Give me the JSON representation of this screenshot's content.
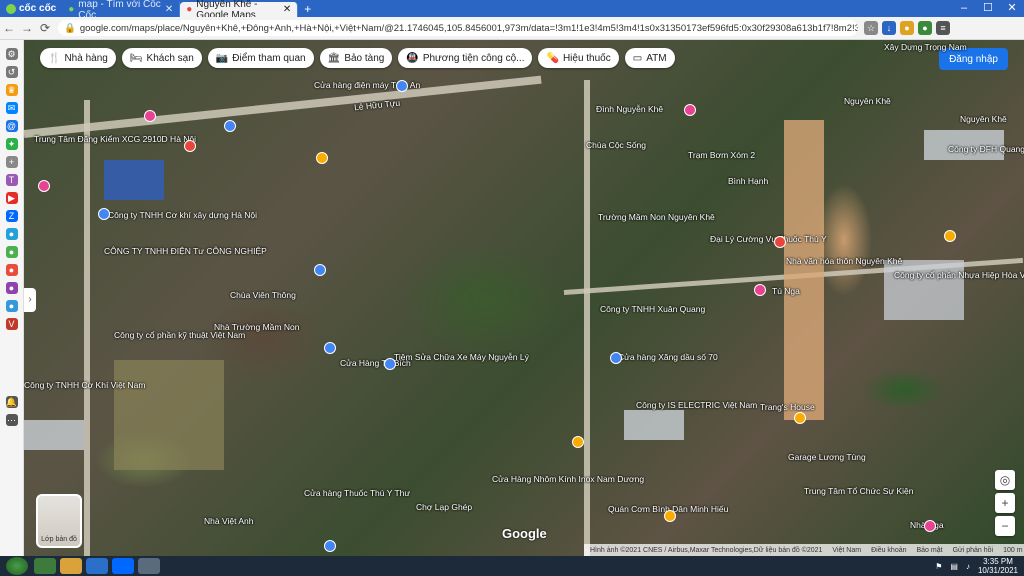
{
  "browser": {
    "brand": "cốc cốc",
    "tabs": [
      {
        "label": "map - Tìm với Cốc Cốc",
        "active": false
      },
      {
        "label": "Nguyên Khê - Google Maps",
        "active": true
      }
    ],
    "url": "google.com/maps/place/Nguyên+Khê,+Đông+Anh,+Hà+Nội,+Việt+Nam/@21.1746045,105.8456001,973m/data=!3m1!1e3!4m5!3m4!1s0x31350173ef596fd5:0x30f29308a613b1f7!8m2!3d21.177006!4d105.8349009"
  },
  "map": {
    "chips": [
      {
        "icon": "restaurant-icon",
        "label": "Nhà hàng"
      },
      {
        "icon": "hotel-icon",
        "label": "Khách sạn"
      },
      {
        "icon": "camera-icon",
        "label": "Điểm tham quan"
      },
      {
        "icon": "museum-icon",
        "label": "Bảo tàng"
      },
      {
        "icon": "transit-icon",
        "label": "Phương tiện công cộ..."
      },
      {
        "icon": "pharmacy-icon",
        "label": "Hiệu thuốc"
      },
      {
        "icon": "atm-icon",
        "label": "ATM"
      }
    ],
    "signin": "Đăng nhập",
    "layer_label": "Lớp bản đồ",
    "google_logo": "Google",
    "labels": [
      "Lê Hữu Tựu",
      "Nguyên Khê",
      "Nguyên Khê",
      "Trung Tâm Đăng Kiểm XCG 2910D Hà Nội",
      "Cửa hàng điện máy Tâm An",
      "Công ty TNHH Cơ khí xây dựng Hà Nội",
      "CÔNG TY TNHH ĐIỆN Tư CÔNG NGHIỆP",
      "Chùa Viên Thông",
      "Công ty cổ phần kỹ thuật Việt Nam",
      "Nhà Trường Mầm Non",
      "Cửa Hàng Tú Bích",
      "Tiệm Sửa Chữa Xe Máy Nguyễn Lý",
      "Đình Nguyễn Khê",
      "Chùa Cộc Sống",
      "Trường Mầm Non Nguyên Khê",
      "Bình Hạnh",
      "Trạm Bơm Xóm 2",
      "Đại Lý Cường Vụ Thuốc Thú Y",
      "Nhà văn hóa thôn Nguyên Khê",
      "Tú Nga",
      "Công ty TNHH Xuân Quang",
      "Cửa hàng Xăng dầu số 70",
      "Công ty IS ELECTRIC Việt Nam",
      "Trang's House",
      "Garage Lương Tùng",
      "Trung Tâm Tổ Chức Sự Kiện",
      "Quán Cơm Bình Dân Minh Hiếu",
      "Cửa Hàng Nhôm Kính Inox Nam Dương",
      "Nhà Việt Anh",
      "Chợ Lạp Ghép",
      "Công ty TNHH Cơ Khí Việt Nam",
      "Công ty cổ phần Nhựa Hiệp Hòa Việt Nam",
      "Công ty ĐFH Quang Minh",
      "Xây Dựng Trọng Nam",
      "Nhà Nga",
      "Cửa hàng Thuốc Thú Y Thư"
    ],
    "footer": [
      "Hình ảnh ©2021 CNES / Airbus,Maxar Technologies,Dữ liệu bản đồ ©2021",
      "Việt Nam",
      "Điều khoản",
      "Bảo mật",
      "Gửi phản hồi",
      "100 m"
    ]
  },
  "taskbar": {
    "time": "3:35 PM",
    "date": "10/31/2021"
  }
}
